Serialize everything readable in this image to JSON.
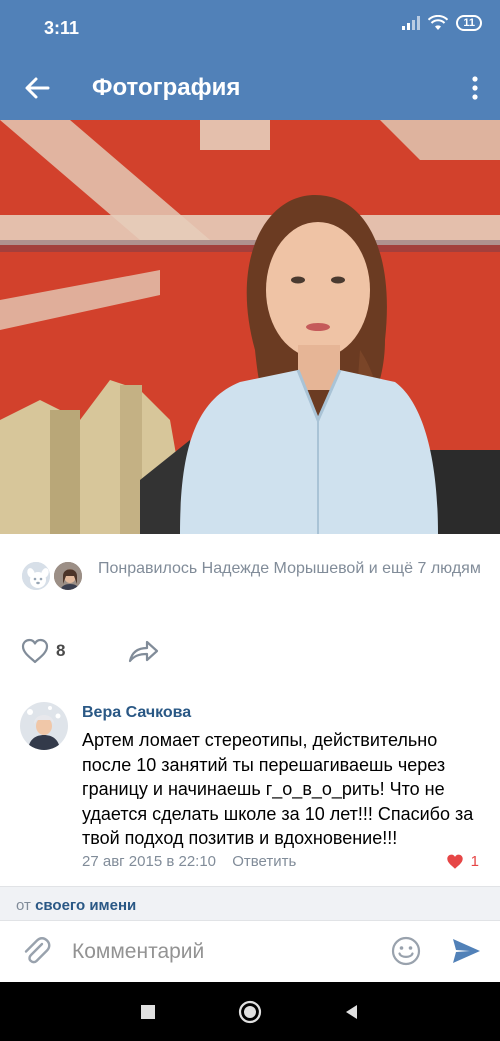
{
  "status_bar": {
    "time": "3:11",
    "battery": "11"
  },
  "toolbar": {
    "title": "Фотография",
    "back_icon": "arrow-back-icon",
    "more_icon": "more-vertical-icon"
  },
  "likes": {
    "text": "Понравилось Надежде Морышевой и ещё 7 людям"
  },
  "actions": {
    "like_count": "8"
  },
  "comment": {
    "author": "Вера Сачкова",
    "text": "Артем ломает стереотипы, действительно после 10 занятий ты перешагиваешь через границу и начинаешь г_о_в_о_рить! Что не удается сделать школе за 10 лет!!! Спасибо за твой подход позитив и вдохновение!!!",
    "date": "27 авг 2015 в 22:10",
    "reply_label": "Ответить",
    "like_count": "1"
  },
  "from_bar": {
    "prefix": "от",
    "link": "своего имени"
  },
  "input": {
    "placeholder": "Комментарий"
  },
  "colors": {
    "header": "#5181b8",
    "link": "#2a5885",
    "secondary": "#818c99",
    "like": "#e64646",
    "send": "#5181b8"
  }
}
